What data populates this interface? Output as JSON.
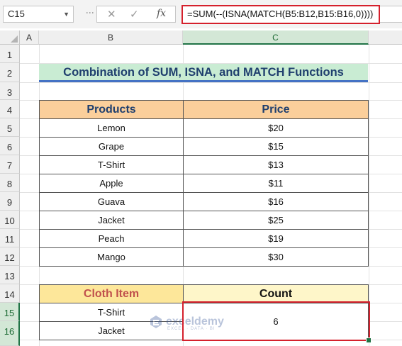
{
  "formula_bar": {
    "name_box": "C15",
    "formula": "=SUM(--(ISNA(MATCH(B5:B12,B15:B16,0))))",
    "cancel_icon": "x-icon",
    "enter_icon": "check-icon",
    "fx_label": "fx"
  },
  "columns": [
    "A",
    "B",
    "C"
  ],
  "rows": [
    "1",
    "2",
    "3",
    "4",
    "5",
    "6",
    "7",
    "8",
    "9",
    "10",
    "11",
    "12",
    "13",
    "14",
    "15",
    "16"
  ],
  "title": "Combination of SUM, ISNA, and MATCH Functions",
  "products_table": {
    "headers": [
      "Products",
      "Price"
    ],
    "rows": [
      [
        "Lemon",
        "$20"
      ],
      [
        "Grape",
        "$15"
      ],
      [
        "T-Shirt",
        "$13"
      ],
      [
        "Apple",
        "$11"
      ],
      [
        "Guava",
        "$16"
      ],
      [
        "Jacket",
        "$25"
      ],
      [
        "Peach",
        "$19"
      ],
      [
        "Mango",
        "$30"
      ]
    ]
  },
  "count_table": {
    "headers": [
      "Cloth Item",
      "Count"
    ],
    "items": [
      "T-Shirt",
      "Jacket"
    ],
    "result": "6"
  },
  "watermark": {
    "name": "exceldemy",
    "tagline": "EXCEL · DATA · BI"
  },
  "colors": {
    "selection_green": "#217346",
    "highlight_red": "#d5202c",
    "title_bg": "#c9ecd3",
    "header_orange": "#fbcf9b",
    "header_yellow": "#fde79a"
  }
}
